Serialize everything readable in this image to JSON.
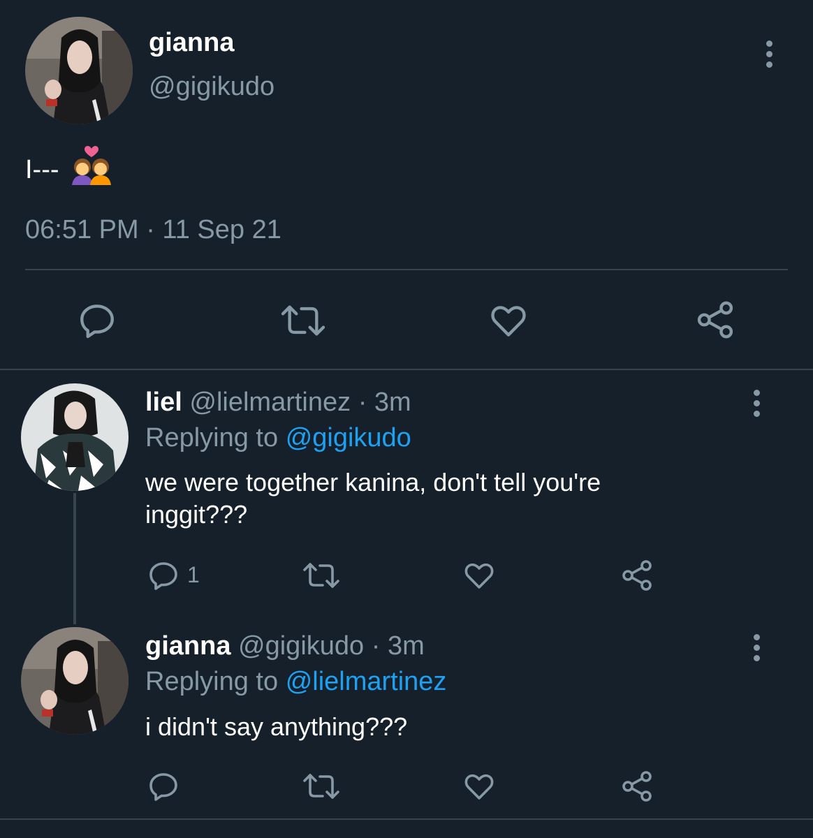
{
  "main_tweet": {
    "name": "gianna",
    "handle": "@gigikudo",
    "text": "I---",
    "emoji": "👩‍❤️‍👩",
    "timestamp": "06:51 PM · 11 Sep 21",
    "icons": [
      "comment-icon",
      "retweet-icon",
      "like-icon",
      "share-icon"
    ]
  },
  "replies": [
    {
      "name": "liel",
      "handle": "@lielmartinez",
      "time": "· 3m",
      "replying_label": "Replying to",
      "replying_to": "@gigikudo",
      "text_line1": "we were together kanina, don't tell you're",
      "text_line2": "inggit???",
      "reply_count": "1"
    },
    {
      "name": "gianna",
      "handle": "@gigikudo",
      "time": "· 3m",
      "replying_label": "Replying to",
      "replying_to": "@lielmartinez",
      "text_line1": "i didn't say anything???",
      "reply_count": ""
    }
  ],
  "colors": {
    "background": "#15202b",
    "secondary_text": "#8899a6",
    "mention": "#1da1f2",
    "divider": "#38444d"
  }
}
